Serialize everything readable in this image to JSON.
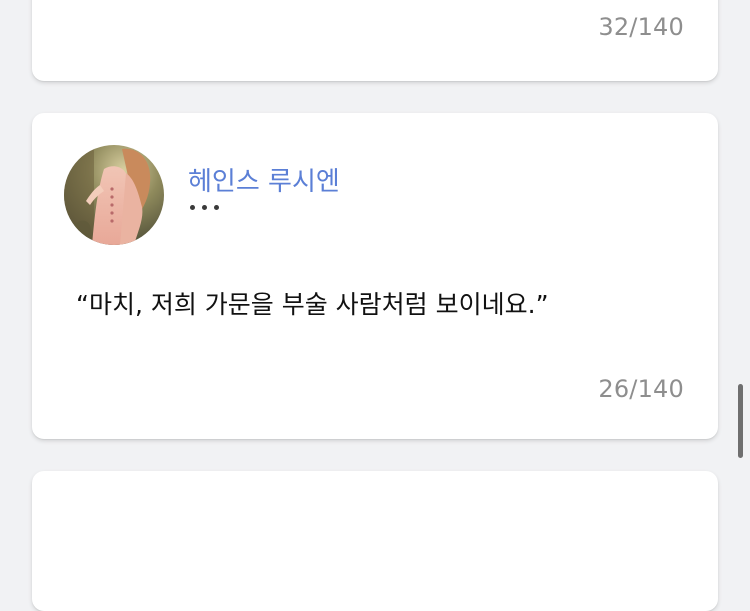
{
  "feed": {
    "cards": [
      {
        "counter": "32/140"
      },
      {
        "author": "헤인스 루시엔",
        "quote": "“마치, 저희 가문을 부술 사람처럼 보이네요.”",
        "counter": "26/140",
        "avatar_icon": "profile-photo"
      },
      {}
    ]
  },
  "colors": {
    "background": "#f1f2f4",
    "card": "#ffffff",
    "author_name": "#5b7fd6",
    "counter": "#8e8e8e"
  }
}
